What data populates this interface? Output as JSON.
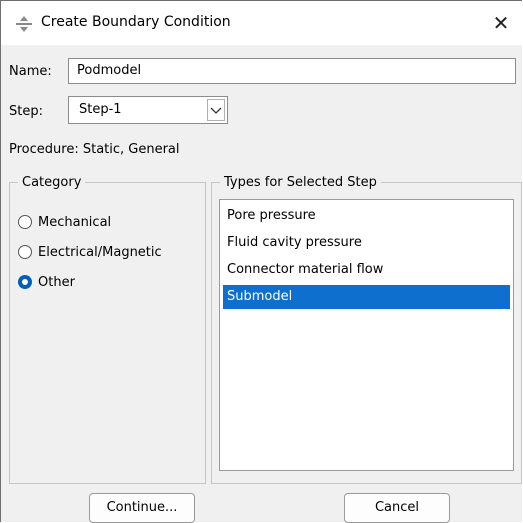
{
  "window": {
    "title": "Create Boundary Condition",
    "icon": "boundary-condition-icon",
    "close_symbol": "✕"
  },
  "name_field": {
    "label": "Name:",
    "value": "Podmodel"
  },
  "step_field": {
    "label": "Step:",
    "value": "Step-1"
  },
  "procedure": {
    "label": "Procedure:",
    "value": "Static, General"
  },
  "category": {
    "title": "Category",
    "options": [
      {
        "label": "Mechanical",
        "checked": false
      },
      {
        "label": "Electrical/Magnetic",
        "checked": false
      },
      {
        "label": "Other",
        "checked": true
      }
    ]
  },
  "types": {
    "title": "Types for Selected Step",
    "items": [
      {
        "label": "Pore pressure",
        "selected": false
      },
      {
        "label": "Fluid cavity pressure",
        "selected": false
      },
      {
        "label": "Connector material flow",
        "selected": false
      },
      {
        "label": "Submodel",
        "selected": true
      }
    ]
  },
  "buttons": {
    "continue": "Continue...",
    "cancel": "Cancel"
  },
  "colors": {
    "accent": "#005fb8",
    "selection": "#0f6fcf",
    "dialog_bg": "#f0f0f0"
  }
}
